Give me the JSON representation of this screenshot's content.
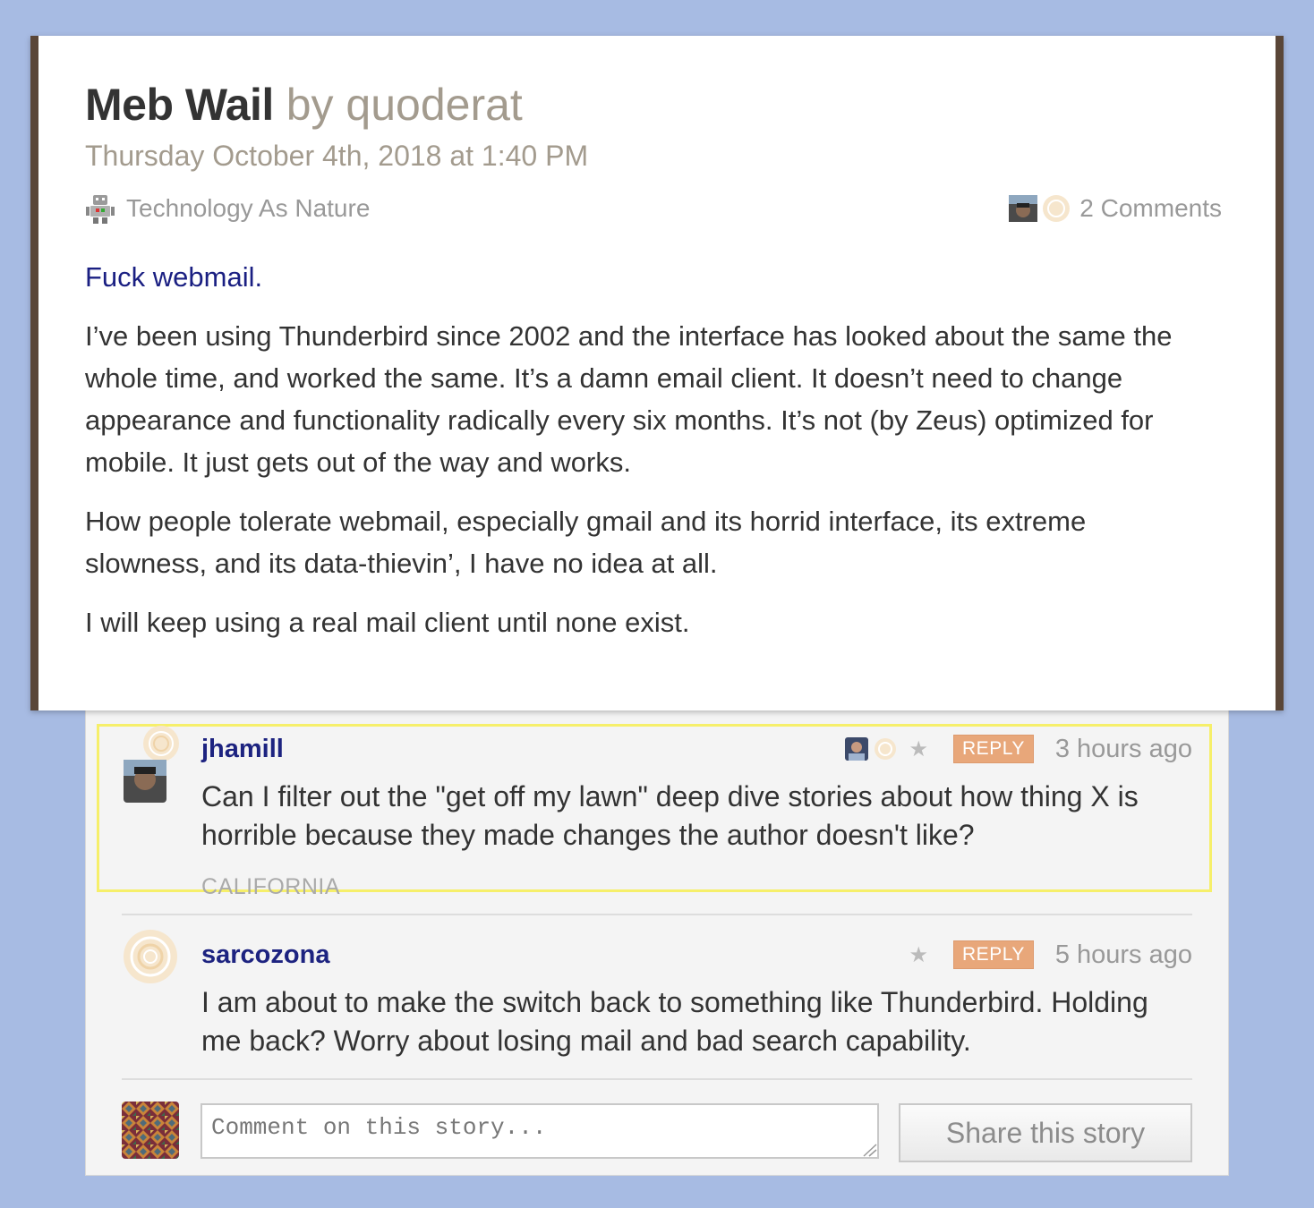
{
  "story": {
    "title": "Meb Wail",
    "byline": "by quoderat",
    "date": "Thursday October 4th, 2018 at 1:40 PM",
    "feed_name": "Technology As Nature",
    "feed_icon": "robot-icon",
    "comment_count_label": "2 Comments",
    "paragraphs": [
      "Fuck webmail.",
      "I’ve been using Thunderbird since 2002 and the interface has looked about the same the whole time, and worked the same. It’s a damn email client. It doesn’t need to change appearance and functionality radically every six months. It’s not (by Zeus) optimized for mobile. It just gets out of the way and works.",
      "How people tolerate webmail, especially gmail and its horrid interface, its extreme slowness, and its data-thievin’, I have no idea at all.",
      "I will keep using a real mail client until none exist."
    ]
  },
  "comments": [
    {
      "username": "jhamill",
      "text": "Can I filter out the \"get off my lawn\" deep dive stories about how thing X is horrible because they made changes the author doesn't like?",
      "reply_label": "REPLY",
      "time_ago": "3 hours ago",
      "location": "CALIFORNIA",
      "star": "★"
    },
    {
      "username": "sarcozona",
      "text": "I am about to make the switch back to something like Thunderbird. Holding me back? Worry about losing mail and bad search capability.",
      "reply_label": "REPLY",
      "time_ago": "5 hours ago",
      "star": "★"
    }
  ],
  "composer": {
    "placeholder": "Comment on this story...",
    "share_label": "Share this story"
  },
  "colors": {
    "background": "#a7bbe3",
    "story_border": "#5a4638",
    "link": "#1a1f82",
    "username": "#1d2380",
    "reply_button": "#e8a77a",
    "highlight": "#f6ef6a"
  }
}
